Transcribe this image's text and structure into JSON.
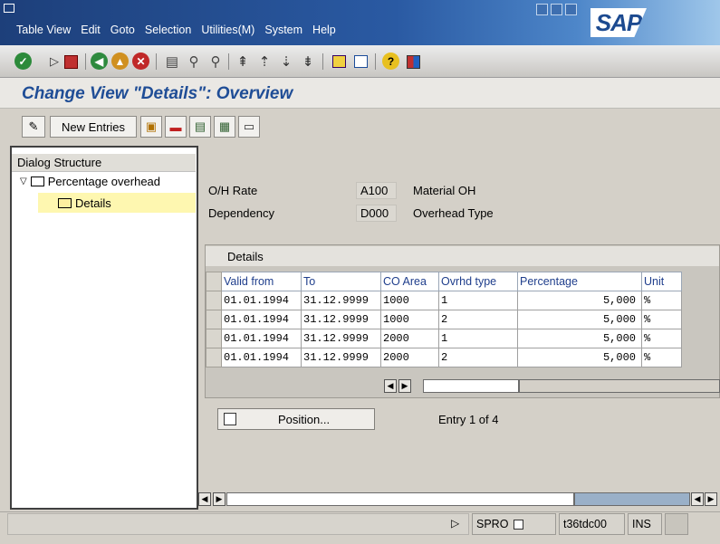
{
  "menu": [
    {
      "label": "Table View"
    },
    {
      "label": "Edit"
    },
    {
      "label": "Goto"
    },
    {
      "label": "Selection"
    },
    {
      "label": "Utilities(M)"
    },
    {
      "label": "System"
    },
    {
      "label": "Help"
    }
  ],
  "brand": {
    "logo_text": "SAP",
    "title_bar_color": "#2a5aa3",
    "title_text_color": "#1f4d96"
  },
  "toolbar_icons": [
    "enter-icon",
    "back-triangle-icon",
    "save-icon",
    "back-icon",
    "exit-icon",
    "cancel-icon",
    "print-icon",
    "find-icon",
    "find-next-icon",
    "first-page-icon",
    "prev-page-icon",
    "next-page-icon",
    "last-page-icon",
    "create-session-icon",
    "shortcut-icon",
    "help-icon",
    "layout-icon"
  ],
  "page": {
    "title": "Change View \"Details\": Overview"
  },
  "app_toolbar": {
    "new_entries_label": "New Entries"
  },
  "dialog_structure": {
    "title": "Dialog Structure",
    "items": [
      {
        "label": "Percentage overhead"
      },
      {
        "label": "Details"
      }
    ]
  },
  "fields": {
    "oh_rate_label": "O/H Rate",
    "oh_rate_value": "A100",
    "oh_rate_text": "Material OH",
    "dependency_label": "Dependency",
    "dependency_value": "D000",
    "dependency_text": "Overhead Type"
  },
  "table": {
    "caption": "Details",
    "columns": [
      "Valid from",
      "To",
      "CO Area",
      "Ovrhd type",
      "Percentage",
      "Unit"
    ],
    "rows": [
      [
        "01.01.1994",
        "31.12.9999",
        "1000",
        "1",
        "5,000",
        "%"
      ],
      [
        "01.01.1994",
        "31.12.9999",
        "1000",
        "2",
        "5,000",
        "%"
      ],
      [
        "01.01.1994",
        "31.12.9999",
        "2000",
        "1",
        "5,000",
        "%"
      ],
      [
        "01.01.1994",
        "31.12.9999",
        "2000",
        "2",
        "5,000",
        "%"
      ]
    ]
  },
  "position": {
    "button_label": "Position...",
    "entry_text": "Entry 1 of 4"
  },
  "status": {
    "system": "SPRO",
    "server": "t36tdc00",
    "mode": "INS"
  }
}
